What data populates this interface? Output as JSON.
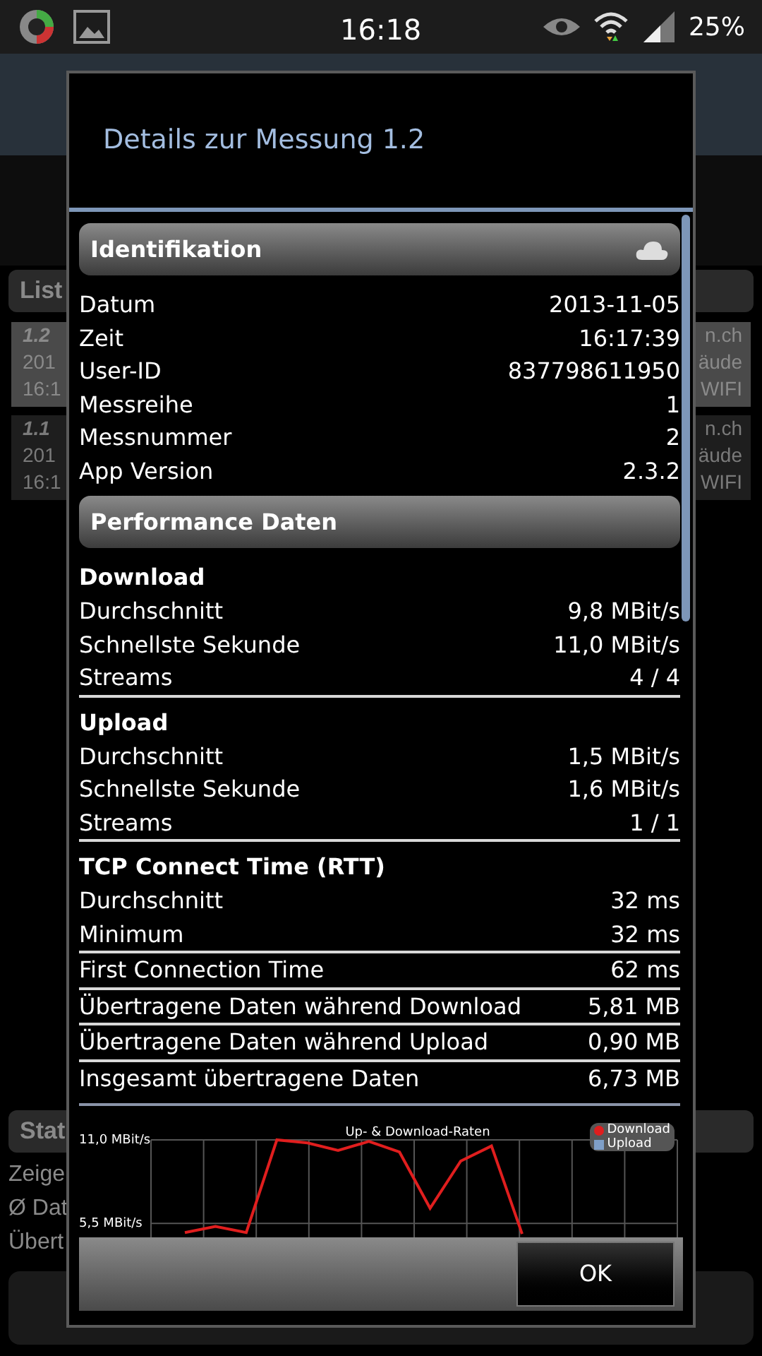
{
  "status_bar": {
    "time": "16:18",
    "battery": "25%"
  },
  "background": {
    "list_header": "List",
    "list_rows": [
      {
        "number": "1.2",
        "date": "201",
        "time": "16:1",
        "right": [
          "n.ch",
          "äude",
          "WIFI"
        ],
        "selected": true
      },
      {
        "number": "1.1",
        "date": "201",
        "time": "16:1",
        "right": [
          "n.ch",
          "äude",
          "WIFI"
        ],
        "selected": false
      }
    ],
    "stats_header": "Stat",
    "stats_lines": [
      "Zeige",
      "Ø Dat",
      "Übert"
    ]
  },
  "dialog": {
    "title": "Details zur Messung 1.2",
    "sections": [
      {
        "title": "Identifikation",
        "cloud_icon": true,
        "items": [
          {
            "kind": "row",
            "label": "Datum",
            "value": "2013-11-05"
          },
          {
            "kind": "row",
            "label": "Zeit",
            "value": "16:17:39"
          },
          {
            "kind": "row",
            "label": "User-ID",
            "value": "837798611950"
          },
          {
            "kind": "row",
            "label": "Messreihe",
            "value": "1"
          },
          {
            "kind": "row",
            "label": "Messnummer",
            "value": "2"
          },
          {
            "kind": "row",
            "label": "App Version",
            "value": "2.3.2"
          }
        ]
      },
      {
        "title": "Performance Daten",
        "cloud_icon": false,
        "items": [
          {
            "kind": "heading",
            "label": "Download"
          },
          {
            "kind": "row",
            "label": "Durchschnitt",
            "value": "9,8 MBit/s"
          },
          {
            "kind": "row",
            "label": "Schnellste Sekunde",
            "value": "11,0 MBit/s"
          },
          {
            "kind": "row",
            "label": "Streams",
            "value": "4 / 4"
          },
          {
            "kind": "divider"
          },
          {
            "kind": "heading",
            "label": "Upload"
          },
          {
            "kind": "row",
            "label": "Durchschnitt",
            "value": "1,5 MBit/s"
          },
          {
            "kind": "row",
            "label": "Schnellste Sekunde",
            "value": "1,6 MBit/s"
          },
          {
            "kind": "row",
            "label": "Streams",
            "value": "1 / 1"
          },
          {
            "kind": "divider"
          },
          {
            "kind": "heading",
            "label": "TCP Connect Time (RTT)"
          },
          {
            "kind": "row",
            "label": "Durchschnitt",
            "value": "32 ms"
          },
          {
            "kind": "row",
            "label": "Minimum",
            "value": "32 ms"
          },
          {
            "kind": "divider"
          },
          {
            "kind": "row",
            "label": "First Connection Time",
            "value": "62 ms"
          },
          {
            "kind": "divider"
          },
          {
            "kind": "row",
            "label": "Übertragene Daten während Download",
            "value": "5,81 MB"
          },
          {
            "kind": "divider"
          },
          {
            "kind": "row",
            "label": "Übertragene Daten während Upload",
            "value": "0,90 MB"
          },
          {
            "kind": "divider"
          },
          {
            "kind": "row",
            "label": "Insgesamt übertragene Daten",
            "value": "6,73 MB"
          }
        ]
      }
    ],
    "chart_data": {
      "type": "line",
      "title": "Up- & Download-Raten",
      "categories": [
        null,
        null,
        null,
        null,
        null,
        null,
        null,
        null,
        null,
        null,
        null,
        null
      ],
      "ylim": [
        4.3,
        11.0
      ],
      "grid": true,
      "yticks": [
        {
          "value": 5.5,
          "label": "5,5 MBit/s"
        },
        {
          "value": 11.0,
          "label": "11,0 MBit/s"
        }
      ],
      "series": [
        {
          "name": "Download",
          "color": "#e01e1e",
          "values": [
            4.9,
            5.3,
            4.9,
            11.0,
            10.8,
            10.3,
            10.9,
            10.2,
            6.5,
            9.6,
            10.6,
            4.8
          ]
        },
        {
          "name": "Upload",
          "color": "#7f9fc8",
          "values": [
            null,
            null,
            null,
            null,
            null,
            null,
            null,
            null,
            null,
            null,
            null,
            null
          ]
        }
      ]
    },
    "ok_button": "OK"
  }
}
